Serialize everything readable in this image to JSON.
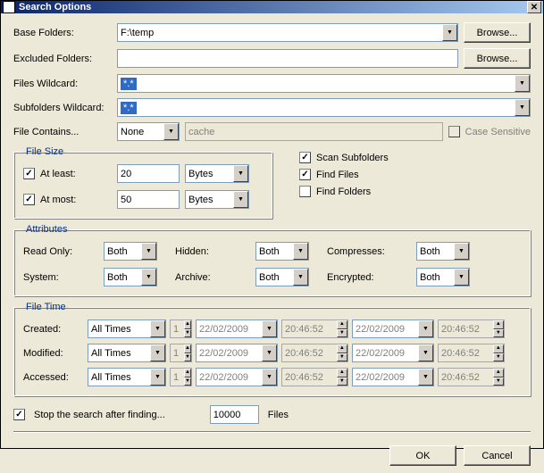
{
  "window": {
    "title": "Search Options"
  },
  "labels": {
    "baseFolders": "Base Folders:",
    "excludedFolders": "Excluded Folders:",
    "filesWildcard": "Files Wildcard:",
    "subfoldersWildcard": "Subfolders Wildcard:",
    "fileContains": "File Contains...",
    "caseSensitive": "Case Sensitive",
    "browse": "Browse..."
  },
  "fields": {
    "baseFolders": "F:\\temp",
    "excludedFolders": "",
    "filesWildcard": "*.*",
    "subfoldersWildcard": "*.*",
    "fileContainsMode": "None",
    "fileContainsText": "cache"
  },
  "filesize": {
    "legend": "File Size",
    "atLeastLabel": "At least:",
    "atLeastChecked": true,
    "atLeastValue": "20",
    "atLeastUnit": "Bytes",
    "atMostLabel": "At most:",
    "atMostChecked": true,
    "atMostValue": "50",
    "atMostUnit": "Bytes"
  },
  "options": {
    "scanSubfolders": {
      "label": "Scan Subfolders",
      "checked": true
    },
    "findFiles": {
      "label": "Find Files",
      "checked": true
    },
    "findFolders": {
      "label": "Find Folders",
      "checked": false
    }
  },
  "attributes": {
    "legend": "Attributes",
    "readOnly": {
      "label": "Read Only:",
      "value": "Both"
    },
    "hidden": {
      "label": "Hidden:",
      "value": "Both"
    },
    "compresses": {
      "label": "Compresses:",
      "value": "Both"
    },
    "system": {
      "label": "System:",
      "value": "Both"
    },
    "archive": {
      "label": "Archive:",
      "value": "Both"
    },
    "encrypted": {
      "label": "Encrypted:",
      "value": "Both"
    }
  },
  "filetime": {
    "legend": "File Time",
    "rows": {
      "created": {
        "label": "Created:",
        "mode": "All Times",
        "n": "1",
        "d1": "22/02/2009",
        "t1": "20:46:52",
        "d2": "22/02/2009",
        "t2": "20:46:52"
      },
      "modified": {
        "label": "Modified:",
        "mode": "All Times",
        "n": "1",
        "d1": "22/02/2009",
        "t1": "20:46:52",
        "d2": "22/02/2009",
        "t2": "20:46:52"
      },
      "accessed": {
        "label": "Accessed:",
        "mode": "All Times",
        "n": "1",
        "d1": "22/02/2009",
        "t1": "20:46:52",
        "d2": "22/02/2009",
        "t2": "20:46:52"
      }
    }
  },
  "stop": {
    "label": "Stop the search after finding...",
    "checked": true,
    "value": "10000",
    "unit": "Files"
  },
  "buttons": {
    "ok": "OK",
    "cancel": "Cancel"
  }
}
